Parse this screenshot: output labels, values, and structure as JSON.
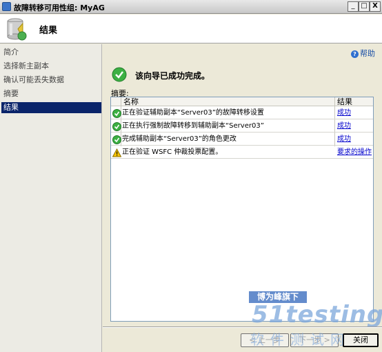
{
  "window": {
    "title": "故障转移可用性组: MyAG",
    "buttons": {
      "minimize": "_",
      "maximize": "□",
      "close": "X"
    }
  },
  "header": {
    "title": "结果",
    "icon": "database-wizard-icon"
  },
  "nav": {
    "items": [
      {
        "label": "简介",
        "active": false
      },
      {
        "label": "选择新主副本",
        "active": false
      },
      {
        "label": "确认可能丢失数据",
        "active": false
      },
      {
        "label": "摘要",
        "active": false
      },
      {
        "label": "结果",
        "active": true
      }
    ]
  },
  "main": {
    "help": "帮助",
    "status_title": "该向导已成功完成。",
    "summary_label": "摘要:",
    "table": {
      "headers": {
        "name": "名称",
        "result": "结果"
      },
      "rows": [
        {
          "icon": "success-icon",
          "name": "正在验证辅助副本“Server03”的故障转移设置",
          "result": "成功"
        },
        {
          "icon": "success-icon",
          "name": "正在执行强制故障转移到辅助副本“Server03”",
          "result": "成功"
        },
        {
          "icon": "success-icon",
          "name": "完成辅助副本“Server03”的角色更改",
          "result": "成功"
        },
        {
          "icon": "warning-icon",
          "name": "正在验证 WSFC 仲裁投票配置。",
          "result": "要求的操作"
        }
      ]
    }
  },
  "footer": {
    "prev": "< 上一步",
    "next": "下一步 >",
    "close": "关闭"
  },
  "watermark": {
    "banner": "博为峰旗下",
    "logo": "51testing",
    "sub": "软件测试网"
  },
  "colors": {
    "nav_active": "#0a246a",
    "link": "#0000cc",
    "success": "#2ea44f",
    "warning": "#f5c400"
  }
}
